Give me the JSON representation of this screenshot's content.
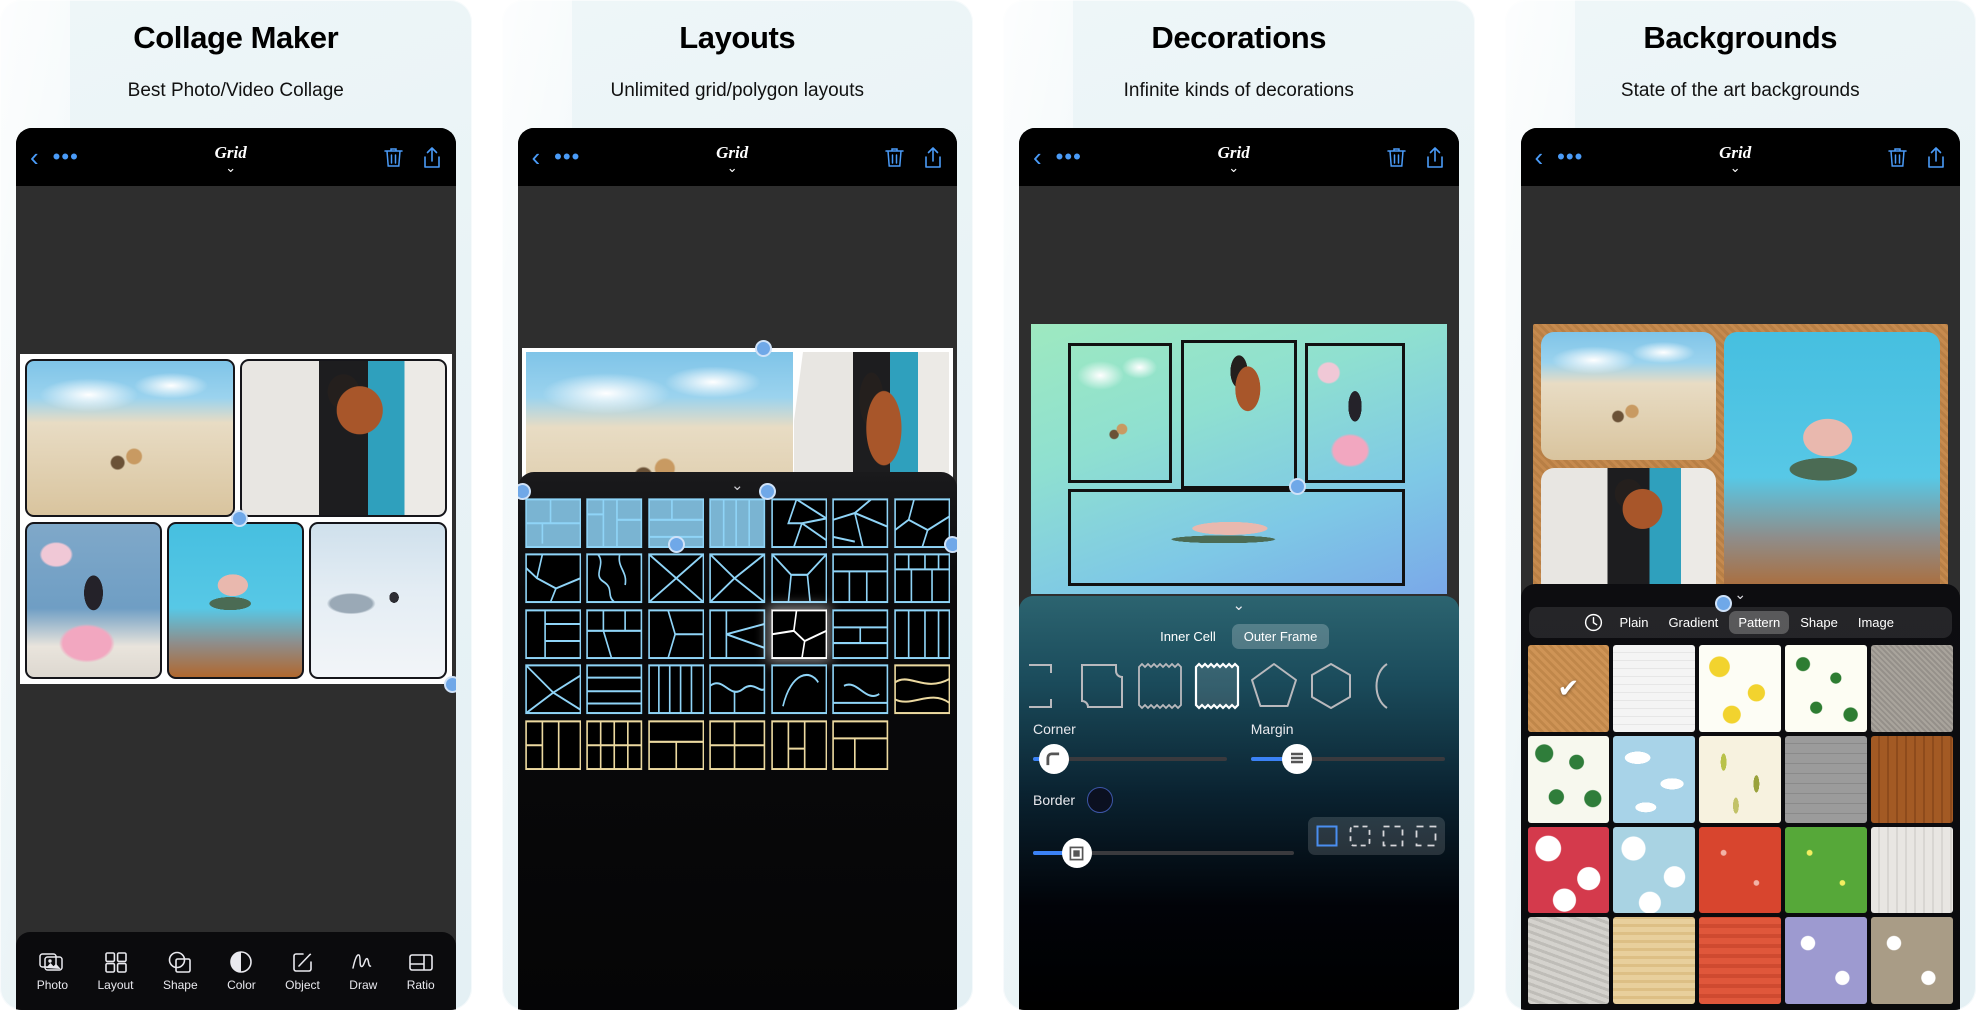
{
  "panels": [
    {
      "title": "Collage Maker",
      "subtitle": "Best Photo/Video Collage",
      "topbar": {
        "back": "‹",
        "more": "•••",
        "title": "Grid",
        "chevron": "⌄",
        "trash": "trash-icon",
        "share": "share-icon"
      },
      "toolbar": [
        {
          "label": "Photo",
          "icon": "photo-icon"
        },
        {
          "label": "Layout",
          "icon": "layout-grid-icon"
        },
        {
          "label": "Shape",
          "icon": "shape-icon"
        },
        {
          "label": "Color",
          "icon": "contrast-icon"
        },
        {
          "label": "Object",
          "icon": "object-edit-icon"
        },
        {
          "label": "Draw",
          "icon": "draw-squiggle-icon"
        },
        {
          "label": "Ratio",
          "icon": "ratio-icon"
        }
      ]
    },
    {
      "title": "Layouts",
      "subtitle": "Unlimited grid/polygon layouts",
      "topbar": {
        "back": "‹",
        "more": "•••",
        "title": "Grid",
        "chevron": "⌄",
        "trash": "trash-icon",
        "share": "share-icon"
      },
      "layout_picker": {
        "grab": "⌄",
        "columns": 7,
        "selected_index": 19,
        "total": 35
      }
    },
    {
      "title": "Decorations",
      "subtitle": "Infinite kinds of decorations",
      "topbar": {
        "back": "‹",
        "more": "•••",
        "title": "Grid",
        "chevron": "⌄",
        "trash": "trash-icon",
        "share": "share-icon"
      },
      "decorations": {
        "grab": "⌄",
        "segments": [
          {
            "label": "Inner Cell",
            "selected": false
          },
          {
            "label": "Outer Frame",
            "selected": true
          }
        ],
        "shapes": [
          "bracket",
          "notched-square",
          "zigzag-square",
          "zigzag-square-selected",
          "pentagon",
          "hexagon",
          "arc"
        ],
        "selected_shape_index": 3,
        "sliders": [
          {
            "label": "Corner",
            "value": 8,
            "knob_icon": "corner-radius-icon"
          },
          {
            "label": "Margin",
            "value": 22,
            "knob_icon": "margin-lines-icon"
          },
          {
            "label": "Border",
            "value": 18,
            "knob_icon": "border-square-icon"
          }
        ],
        "border_label": "Border",
        "border_color_swatch": "#12255c",
        "border_styles": [
          "solid",
          "dashed-round",
          "dashed-square",
          "dashed-wide"
        ],
        "border_style_selected": 0
      }
    },
    {
      "title": "Backgrounds",
      "subtitle": "State of the art backgrounds",
      "topbar": {
        "back": "‹",
        "more": "•••",
        "title": "Grid",
        "chevron": "⌄",
        "trash": "trash-icon",
        "share": "share-icon"
      },
      "backgrounds": {
        "grab": "⌄",
        "tabs": [
          {
            "label": "history-clock-icon",
            "icon": true,
            "selected": false
          },
          {
            "label": "Plain",
            "selected": false
          },
          {
            "label": "Gradient",
            "selected": false
          },
          {
            "label": "Pattern",
            "selected": true
          },
          {
            "label": "Shape",
            "selected": false
          },
          {
            "label": "Image",
            "selected": false
          }
        ],
        "check_mark": "✔",
        "swatches": [
          {
            "name": "cork",
            "selected": true
          },
          {
            "name": "white-wood",
            "selected": false
          },
          {
            "name": "yellow-leaves",
            "selected": false
          },
          {
            "name": "palm-trees",
            "selected": false
          },
          {
            "name": "grey-fabric",
            "selected": false
          },
          {
            "name": "green-sprouts",
            "selected": false
          },
          {
            "name": "sky-clouds",
            "selected": false
          },
          {
            "name": "cream-feathers",
            "selected": false
          },
          {
            "name": "grey-brick",
            "selected": false
          },
          {
            "name": "dark-wood",
            "selected": false
          },
          {
            "name": "red-polka",
            "selected": false
          },
          {
            "name": "blue-polka",
            "selected": false
          },
          {
            "name": "red-hearts",
            "selected": false
          },
          {
            "name": "green-hearts",
            "selected": false
          },
          {
            "name": "white-plank",
            "selected": false
          },
          {
            "name": "grey-stone",
            "selected": false
          },
          {
            "name": "tan-plaid",
            "selected": false
          },
          {
            "name": "orange-stripes",
            "selected": false
          },
          {
            "name": "purple-crowns",
            "selected": false
          },
          {
            "name": "tan-crowns",
            "selected": false
          }
        ]
      }
    }
  ],
  "colors": {
    "card_bg": "#e9f3f6",
    "accent_blue": "#4a9bf7",
    "handle_blue": "#6fa8e8",
    "sheet_black": "#0a0a0c"
  }
}
